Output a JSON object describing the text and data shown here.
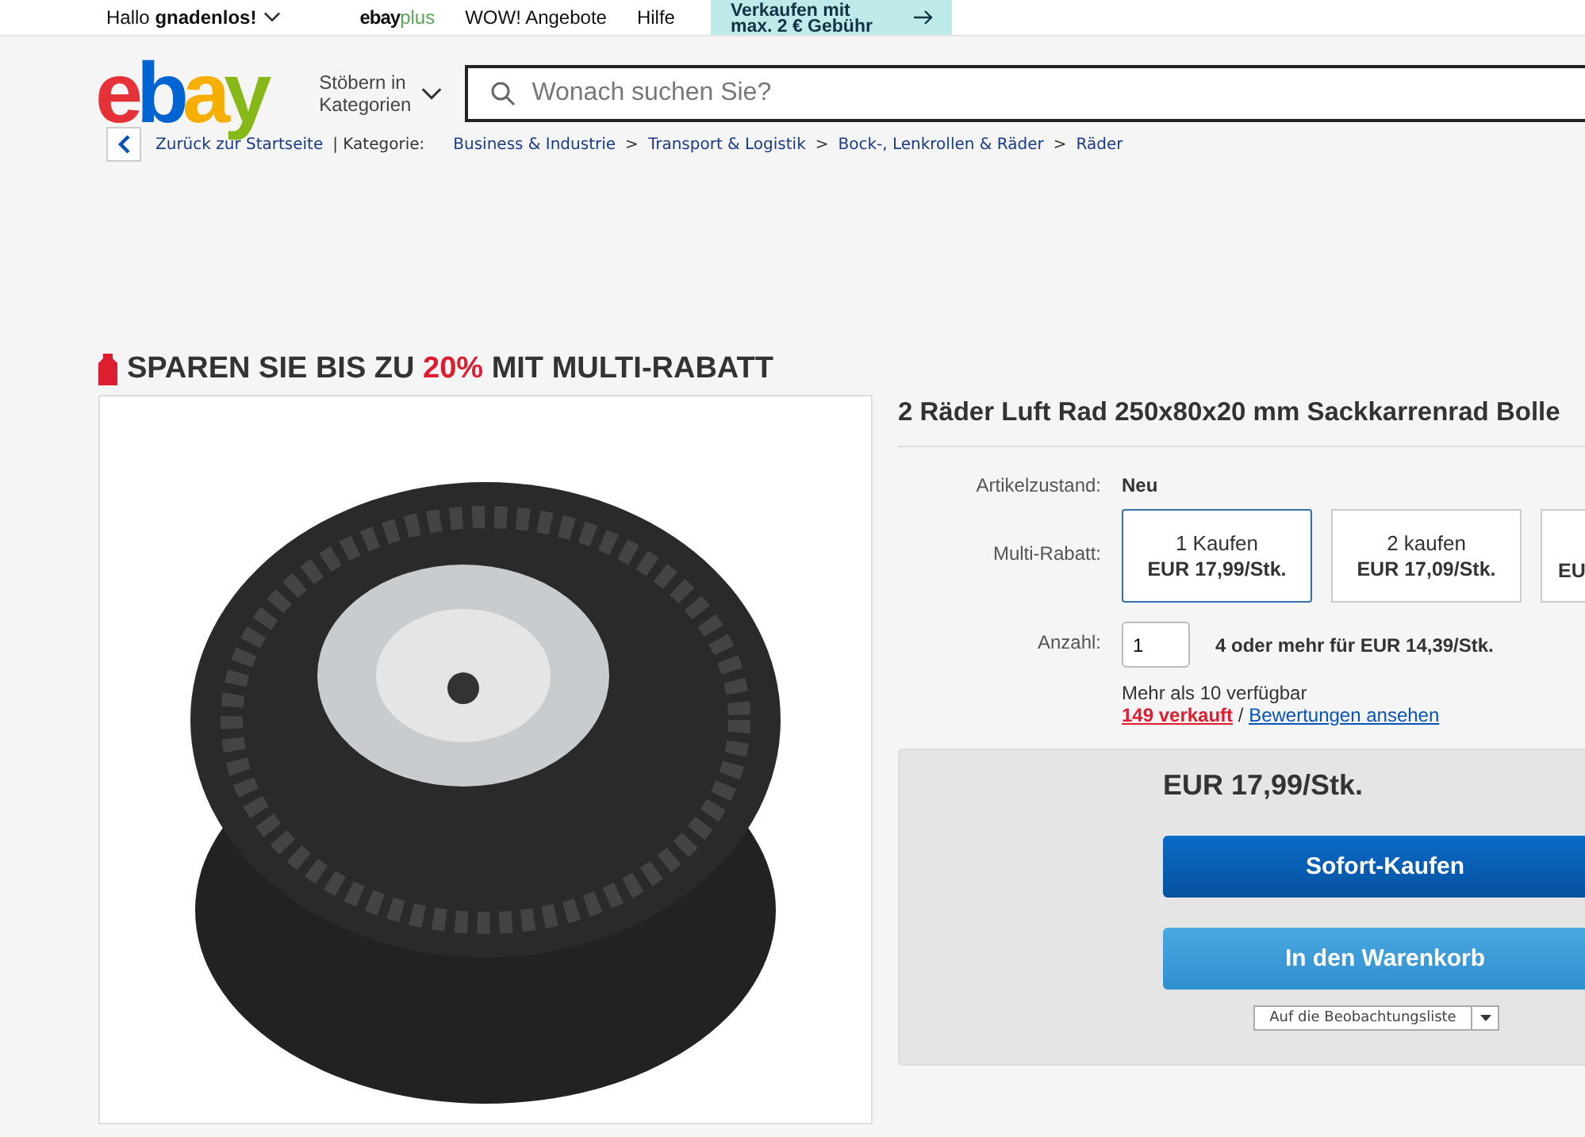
{
  "top_bar": {
    "greeting": "Hallo",
    "user": "gnadenlos!",
    "links": [
      {
        "kind": "brand",
        "parts": [
          "ebay",
          "plus"
        ]
      },
      {
        "kind": "text",
        "parts": [
          "WOW! Angebote"
        ]
      },
      {
        "kind": "text",
        "parts": [
          "Hilfe"
        ]
      }
    ],
    "promo_lines": [
      "Verkaufen mit",
      "max. 2 € Gebühr"
    ]
  },
  "header": {
    "logo": "ebay",
    "browse": [
      "Stöbern in",
      "Kategorien"
    ],
    "search": {
      "placeholder": "Wonach suchen Sie?"
    }
  },
  "breadcrumb": {
    "back": "Zurück zur Startseite",
    "label": "| Kategorie:",
    "items": [
      "Business & Industrie",
      "Transport & Logistik",
      "Bock-, Lenkrollen & Räder",
      "Räder"
    ],
    "separator": ">"
  },
  "promo": {
    "parts": [
      {
        "text": "SPAREN SIE BIS ZU ",
        "highlight": false
      },
      {
        "text": "20%",
        "highlight": true
      },
      {
        "text": " MIT MULTI-RABATT",
        "highlight": false
      }
    ]
  },
  "product": {
    "title": "2 Räder Luft Rad 250x80x20 mm Sackkarrenrad Bolle",
    "condition": {
      "label": "Artikelzustand:",
      "value": "Neu"
    },
    "multi": {
      "label": "Multi-Rabatt:",
      "offers": [
        {
          "qty": "1 Kaufen",
          "price": "EUR 17,99/Stk.",
          "selected": true
        },
        {
          "qty": "2 kaufen",
          "price": "EUR 17,09/Stk.",
          "selected": false
        },
        {
          "price": "EU",
          "selected": false
        }
      ]
    },
    "quantity": {
      "label": "Anzahl:",
      "value": "1",
      "hint": "4 oder mehr für EUR 14,39/Stk."
    },
    "availability": "Mehr als 10 verfügbar",
    "sold": "149 verkauft",
    "sep": "/",
    "reviews": "Bewertungen ansehen",
    "price": "EUR 17,99/Stk.",
    "buy": "Sofort-Kaufen",
    "cart": "In den Warenkorb",
    "watch": "Auf die Beobachtungsliste"
  }
}
